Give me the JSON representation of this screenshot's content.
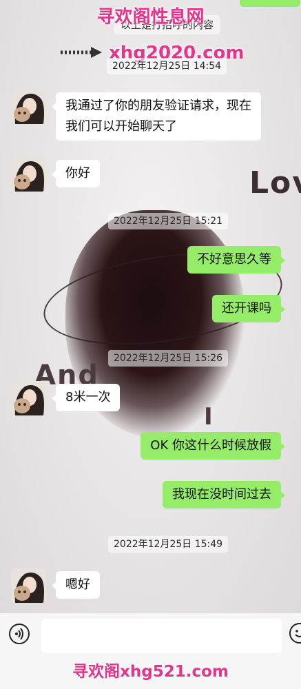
{
  "watermarks": {
    "top_title": "寻欢阁性息网",
    "top_url": "xhg2020.com",
    "bottom": "寻欢阁xhg521.com"
  },
  "background_decor": {
    "word_love": "Lov",
    "word_and": "And",
    "word_fragment": "I"
  },
  "chat": {
    "partial_bubble_top": "以上是打招呼的内容",
    "timestamps": [
      "2022年12月25日 14:54",
      "2022年12月25日 15:21",
      "2022年12月25日 15:26",
      "2022年12月25日 15:49"
    ],
    "messages": [
      {
        "side": "left",
        "text": "我通过了你的朋友验证请求，现在"
      },
      {
        "side": "left",
        "text": "我们可以开始聊天了"
      },
      {
        "side": "left",
        "text": "你好"
      },
      {
        "side": "right",
        "text": "不好意思久等"
      },
      {
        "side": "right",
        "text": "还开课吗"
      },
      {
        "side": "left",
        "text": "8米一次"
      },
      {
        "side": "right",
        "text": "OK  你这什么时候放假"
      },
      {
        "side": "right",
        "text": "我现在没时间过去"
      },
      {
        "side": "left",
        "text": "嗯好"
      }
    ]
  },
  "input_bar": {
    "voice_icon": "voice-icon",
    "emoji_icon": "emoji-icon",
    "placeholder": ""
  },
  "colors": {
    "sent_bubble": "#95ec69",
    "received_bubble": "#ffffff",
    "watermark": "#e4348c"
  }
}
